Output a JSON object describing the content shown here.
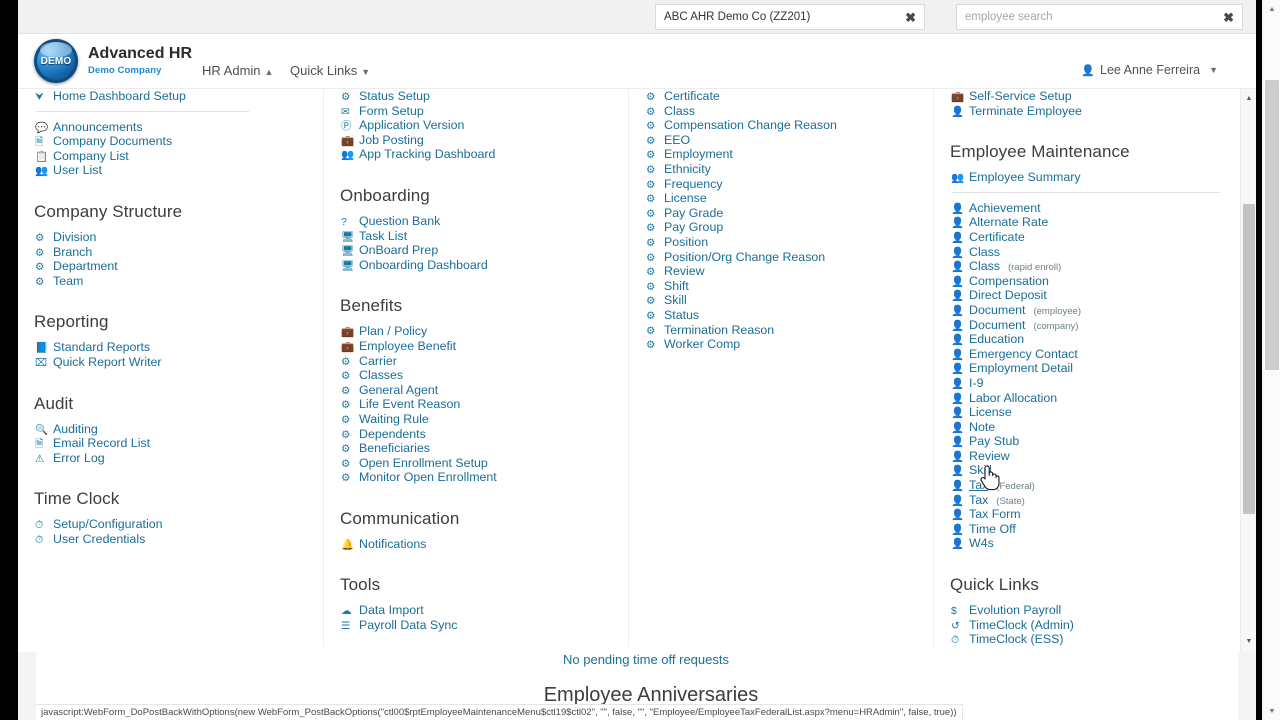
{
  "colors": {
    "link": "#1b6e96",
    "icon": "#1b7aa3",
    "heading": "#3d3d3d",
    "brand_sub": "#1f8ad1"
  },
  "top_bar": {
    "company_search": {
      "value": "ABC AHR Demo Co (ZZ201)",
      "placeholder": "company search",
      "clear_glyph": "✖"
    },
    "employee_search": {
      "value": "",
      "placeholder": "employee search",
      "clear_glyph": "✖"
    }
  },
  "header": {
    "logo_text": "DEMO",
    "brand_title": "Advanced HR",
    "brand_subtitle": "Demo Company",
    "nav": [
      {
        "label": "HR Admin",
        "caret": "▲"
      },
      {
        "label": "Quick Links",
        "caret": "▼"
      }
    ],
    "user": {
      "icon": "👤",
      "name": "Lee Anne Ferreira",
      "caret": "▼"
    }
  },
  "menu": {
    "columns": [
      {
        "id": "column-1",
        "clipped_top": [
          {
            "icon": "⮟",
            "label": "Home Dashboard Setup"
          }
        ],
        "groups": [
          {
            "title": "",
            "divider_before": true,
            "items": [
              {
                "icon": "💬",
                "label": "Announcements"
              },
              {
                "icon": "🗎",
                "label": "Company Documents"
              },
              {
                "icon": "📋",
                "label": "Company List"
              },
              {
                "icon": "👥",
                "label": "User List"
              }
            ]
          },
          {
            "title": "Company Structure",
            "items": [
              {
                "icon": "⚙",
                "label": "Division"
              },
              {
                "icon": "⚙",
                "label": "Branch"
              },
              {
                "icon": "⚙",
                "label": "Department"
              },
              {
                "icon": "⚙",
                "label": "Team"
              }
            ]
          },
          {
            "title": "Reporting",
            "items": [
              {
                "icon": "📘",
                "label": "Standard Reports"
              },
              {
                "icon": "⌧",
                "label": "Quick Report Writer"
              }
            ]
          },
          {
            "title": "Audit",
            "items": [
              {
                "icon": "🔍",
                "label": "Auditing"
              },
              {
                "icon": "🗎",
                "label": "Email Record List"
              },
              {
                "icon": "⚠",
                "label": "Error Log"
              }
            ]
          },
          {
            "title": "Time Clock",
            "items": [
              {
                "icon": "⏱",
                "label": "Setup/Configuration"
              },
              {
                "icon": "⏱",
                "label": "User Credentials"
              }
            ]
          }
        ]
      },
      {
        "id": "column-2",
        "clipped_top": [
          {
            "icon": "⚙",
            "label": "Status Setup"
          }
        ],
        "groups": [
          {
            "title": "",
            "items": [
              {
                "icon": "✉",
                "label": "Form Setup"
              },
              {
                "icon": "Ⓟ",
                "label": "Application Version"
              },
              {
                "icon": "💼",
                "label": "Job Posting"
              },
              {
                "icon": "👥",
                "label": "App Tracking Dashboard"
              }
            ]
          },
          {
            "title": "Onboarding",
            "items": [
              {
                "icon": "?",
                "label": "Question Bank"
              },
              {
                "icon": "🖥",
                "label": "Task List"
              },
              {
                "icon": "🖥",
                "label": "OnBoard Prep"
              },
              {
                "icon": "🖥",
                "label": "Onboarding Dashboard"
              }
            ]
          },
          {
            "title": "Benefits",
            "items": [
              {
                "icon": "💼",
                "label": "Plan / Policy"
              },
              {
                "icon": "💼",
                "label": "Employee Benefit"
              },
              {
                "icon": "⚙",
                "label": "Carrier"
              },
              {
                "icon": "⚙",
                "label": "Classes"
              },
              {
                "icon": "⚙",
                "label": "General Agent"
              },
              {
                "icon": "⚙",
                "label": "Life Event Reason"
              },
              {
                "icon": "⚙",
                "label": "Waiting Rule"
              },
              {
                "icon": "⚙",
                "label": "Dependents"
              },
              {
                "icon": "⚙",
                "label": "Beneficiaries"
              },
              {
                "icon": "⚙",
                "label": "Open Enrollment Setup"
              },
              {
                "icon": "⚙",
                "label": "Monitor Open Enrollment"
              }
            ]
          },
          {
            "title": "Communication",
            "items": [
              {
                "icon": "🔔",
                "label": "Notifications"
              }
            ]
          },
          {
            "title": "Tools",
            "items": [
              {
                "icon": "☁",
                "label": "Data Import"
              },
              {
                "icon": "☰",
                "label": "Payroll Data Sync"
              }
            ]
          }
        ]
      },
      {
        "id": "column-3",
        "clipped_top": [
          {
            "icon": "⚙",
            "label": "Certificate"
          }
        ],
        "groups": [
          {
            "title": "",
            "items": [
              {
                "icon": "⚙",
                "label": "Class"
              },
              {
                "icon": "⚙",
                "label": "Compensation Change Reason"
              },
              {
                "icon": "⚙",
                "label": "EEO"
              },
              {
                "icon": "⚙",
                "label": "Employment"
              },
              {
                "icon": "⚙",
                "label": "Ethnicity"
              },
              {
                "icon": "⚙",
                "label": "Frequency"
              },
              {
                "icon": "⚙",
                "label": "License"
              },
              {
                "icon": "⚙",
                "label": "Pay Grade"
              },
              {
                "icon": "⚙",
                "label": "Pay Group"
              },
              {
                "icon": "⚙",
                "label": "Position"
              },
              {
                "icon": "⚙",
                "label": "Position/Org Change Reason"
              },
              {
                "icon": "⚙",
                "label": "Review"
              },
              {
                "icon": "⚙",
                "label": "Shift"
              },
              {
                "icon": "⚙",
                "label": "Skill"
              },
              {
                "icon": "⚙",
                "label": "Status"
              },
              {
                "icon": "⚙",
                "label": "Termination Reason"
              },
              {
                "icon": "⚙",
                "label": "Worker Comp"
              }
            ]
          }
        ]
      },
      {
        "id": "column-4",
        "clipped_top": [
          {
            "icon": "💼",
            "label": "Self-Service Setup"
          }
        ],
        "groups": [
          {
            "title": "",
            "items": [
              {
                "icon": "👤",
                "label": "Terminate Employee"
              }
            ]
          },
          {
            "title": "Employee Maintenance",
            "items": [
              {
                "icon": "👥",
                "label": "Employee Summary"
              }
            ],
            "divider_after": true
          },
          {
            "title": "",
            "items": [
              {
                "icon": "👤",
                "label": "Achievement"
              },
              {
                "icon": "👤",
                "label": "Alternate Rate"
              },
              {
                "icon": "👤",
                "label": "Certificate"
              },
              {
                "icon": "👤",
                "label": "Class"
              },
              {
                "icon": "👤",
                "label": "Class",
                "qualifier": "(rapid enroll)"
              },
              {
                "icon": "👤",
                "label": "Compensation"
              },
              {
                "icon": "👤",
                "label": "Direct Deposit"
              },
              {
                "icon": "👤",
                "label": "Document",
                "qualifier": "(employee)"
              },
              {
                "icon": "👤",
                "label": "Document",
                "qualifier": "(company)"
              },
              {
                "icon": "👤",
                "label": "Education"
              },
              {
                "icon": "👤",
                "label": "Emergency Contact"
              },
              {
                "icon": "👤",
                "label": "Employment Detail"
              },
              {
                "icon": "👤",
                "label": "I-9"
              },
              {
                "icon": "👤",
                "label": "Labor Allocation"
              },
              {
                "icon": "👤",
                "label": "License"
              },
              {
                "icon": "👤",
                "label": "Note"
              },
              {
                "icon": "👤",
                "label": "Pay Stub"
              },
              {
                "icon": "👤",
                "label": "Review"
              },
              {
                "icon": "👤",
                "label": "Skill"
              },
              {
                "icon": "👤",
                "label": "Tax",
                "qualifier": "(Federal)",
                "hovered": true
              },
              {
                "icon": "👤",
                "label": "Tax",
                "qualifier": "(State)"
              },
              {
                "icon": "👤",
                "label": "Tax Form"
              },
              {
                "icon": "👤",
                "label": "Time Off"
              },
              {
                "icon": "👤",
                "label": "W4s"
              }
            ]
          },
          {
            "title": "Quick Links",
            "items": [
              {
                "icon": "$",
                "label": "Evolution Payroll"
              },
              {
                "icon": "↺",
                "label": "TimeClock (Admin)"
              },
              {
                "icon": "⏱",
                "label": "TimeClock (ESS)"
              }
            ]
          }
        ]
      }
    ]
  },
  "dashboard": {
    "pending_time_off": "No pending time off requests",
    "anniversaries_title": "Employee Anniversaries"
  },
  "status_bar": {
    "text": "javascript:WebForm_DoPostBackWithOptions(new WebForm_PostBackOptions(\"ctl00$rptEmployeeMaintenanceMenu$ctl19$ctl02\", \"\", false, \"\", \"Employee/EmployeeTaxFederalList.aspx?menu=HRAdmin\", false, true))"
  },
  "scrollbars": {
    "up_arrow": "▲",
    "down_arrow": "▼"
  }
}
